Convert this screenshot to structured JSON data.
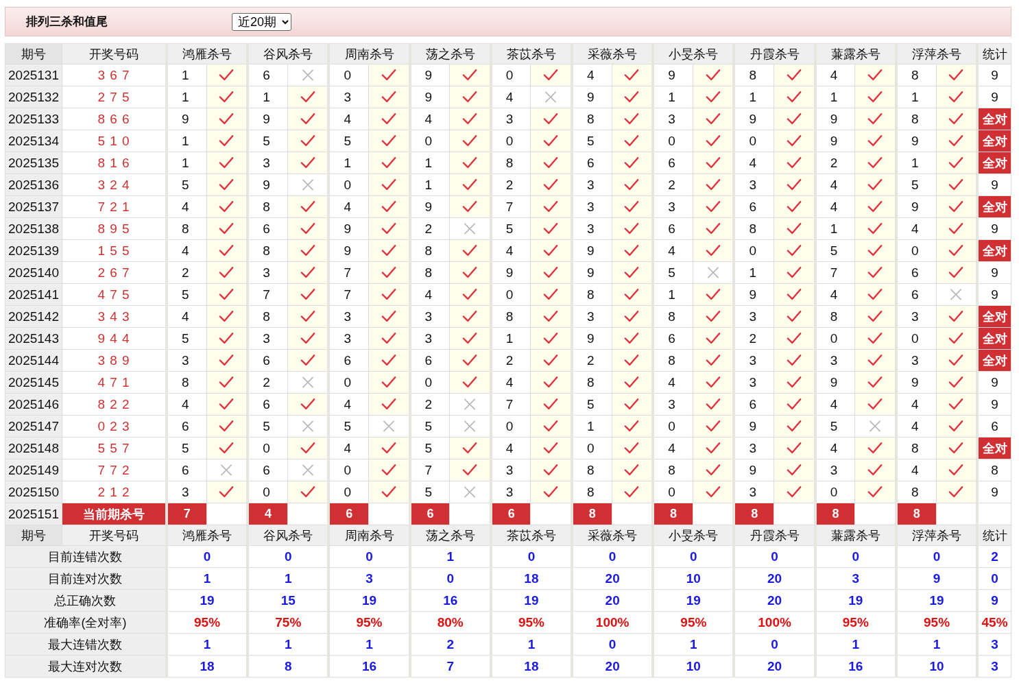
{
  "title": "排列三杀和值尾",
  "period_select": {
    "value": "近20期"
  },
  "columns": [
    "期号",
    "开奖号码",
    "鸿雁杀号",
    "谷风杀号",
    "周南杀号",
    "荡之杀号",
    "茶苡杀号",
    "采薇杀号",
    "小旻杀号",
    "丹霞杀号",
    "蒹露杀号",
    "浮萍杀号",
    "统计"
  ],
  "rows": [
    {
      "period": "2025131",
      "draw": "3 6 7",
      "kills": [
        {
          "digit": "1",
          "hit": true
        },
        {
          "digit": "6",
          "hit": false
        },
        {
          "digit": "0",
          "hit": true
        },
        {
          "digit": "9",
          "hit": true
        },
        {
          "digit": "0",
          "hit": true
        },
        {
          "digit": "4",
          "hit": true
        },
        {
          "digit": "9",
          "hit": true
        },
        {
          "digit": "8",
          "hit": true
        },
        {
          "digit": "4",
          "hit": true
        },
        {
          "digit": "8",
          "hit": true
        }
      ],
      "result": {
        "kind": "count",
        "text": "9"
      }
    },
    {
      "period": "2025132",
      "draw": "2 7 5",
      "kills": [
        {
          "digit": "1",
          "hit": true
        },
        {
          "digit": "1",
          "hit": true
        },
        {
          "digit": "3",
          "hit": true
        },
        {
          "digit": "9",
          "hit": true
        },
        {
          "digit": "4",
          "hit": false
        },
        {
          "digit": "9",
          "hit": true
        },
        {
          "digit": "1",
          "hit": true
        },
        {
          "digit": "1",
          "hit": true
        },
        {
          "digit": "1",
          "hit": true
        },
        {
          "digit": "1",
          "hit": true
        }
      ],
      "result": {
        "kind": "count",
        "text": "9"
      }
    },
    {
      "period": "2025133",
      "draw": "8 6 6",
      "kills": [
        {
          "digit": "9",
          "hit": true
        },
        {
          "digit": "9",
          "hit": true
        },
        {
          "digit": "4",
          "hit": true
        },
        {
          "digit": "4",
          "hit": true
        },
        {
          "digit": "3",
          "hit": true
        },
        {
          "digit": "8",
          "hit": true
        },
        {
          "digit": "3",
          "hit": true
        },
        {
          "digit": "9",
          "hit": true
        },
        {
          "digit": "9",
          "hit": true
        },
        {
          "digit": "8",
          "hit": true
        }
      ],
      "result": {
        "kind": "all",
        "text": "全对"
      }
    },
    {
      "period": "2025134",
      "draw": "5 1 0",
      "kills": [
        {
          "digit": "1",
          "hit": true
        },
        {
          "digit": "5",
          "hit": true
        },
        {
          "digit": "5",
          "hit": true
        },
        {
          "digit": "0",
          "hit": true
        },
        {
          "digit": "0",
          "hit": true
        },
        {
          "digit": "5",
          "hit": true
        },
        {
          "digit": "0",
          "hit": true
        },
        {
          "digit": "0",
          "hit": true
        },
        {
          "digit": "9",
          "hit": true
        },
        {
          "digit": "9",
          "hit": true
        }
      ],
      "result": {
        "kind": "all",
        "text": "全对"
      }
    },
    {
      "period": "2025135",
      "draw": "8 1 6",
      "kills": [
        {
          "digit": "1",
          "hit": true
        },
        {
          "digit": "3",
          "hit": true
        },
        {
          "digit": "1",
          "hit": true
        },
        {
          "digit": "1",
          "hit": true
        },
        {
          "digit": "8",
          "hit": true
        },
        {
          "digit": "6",
          "hit": true
        },
        {
          "digit": "6",
          "hit": true
        },
        {
          "digit": "4",
          "hit": true
        },
        {
          "digit": "2",
          "hit": true
        },
        {
          "digit": "1",
          "hit": true
        }
      ],
      "result": {
        "kind": "all",
        "text": "全对"
      }
    },
    {
      "period": "2025136",
      "draw": "3 2 4",
      "kills": [
        {
          "digit": "5",
          "hit": true
        },
        {
          "digit": "9",
          "hit": false
        },
        {
          "digit": "0",
          "hit": true
        },
        {
          "digit": "1",
          "hit": true
        },
        {
          "digit": "2",
          "hit": true
        },
        {
          "digit": "3",
          "hit": true
        },
        {
          "digit": "2",
          "hit": true
        },
        {
          "digit": "3",
          "hit": true
        },
        {
          "digit": "4",
          "hit": true
        },
        {
          "digit": "5",
          "hit": true
        }
      ],
      "result": {
        "kind": "count",
        "text": "9"
      }
    },
    {
      "period": "2025137",
      "draw": "7 2 1",
      "kills": [
        {
          "digit": "4",
          "hit": true
        },
        {
          "digit": "8",
          "hit": true
        },
        {
          "digit": "4",
          "hit": true
        },
        {
          "digit": "9",
          "hit": true
        },
        {
          "digit": "7",
          "hit": true
        },
        {
          "digit": "3",
          "hit": true
        },
        {
          "digit": "3",
          "hit": true
        },
        {
          "digit": "6",
          "hit": true
        },
        {
          "digit": "4",
          "hit": true
        },
        {
          "digit": "9",
          "hit": true
        }
      ],
      "result": {
        "kind": "all",
        "text": "全对"
      }
    },
    {
      "period": "2025138",
      "draw": "8 9 5",
      "kills": [
        {
          "digit": "8",
          "hit": true
        },
        {
          "digit": "6",
          "hit": true
        },
        {
          "digit": "9",
          "hit": true
        },
        {
          "digit": "2",
          "hit": false
        },
        {
          "digit": "5",
          "hit": true
        },
        {
          "digit": "3",
          "hit": true
        },
        {
          "digit": "6",
          "hit": true
        },
        {
          "digit": "8",
          "hit": true
        },
        {
          "digit": "1",
          "hit": true
        },
        {
          "digit": "4",
          "hit": true
        }
      ],
      "result": {
        "kind": "count",
        "text": "9"
      }
    },
    {
      "period": "2025139",
      "draw": "1 5 5",
      "kills": [
        {
          "digit": "4",
          "hit": true
        },
        {
          "digit": "8",
          "hit": true
        },
        {
          "digit": "9",
          "hit": true
        },
        {
          "digit": "8",
          "hit": true
        },
        {
          "digit": "4",
          "hit": true
        },
        {
          "digit": "9",
          "hit": true
        },
        {
          "digit": "4",
          "hit": true
        },
        {
          "digit": "0",
          "hit": true
        },
        {
          "digit": "5",
          "hit": true
        },
        {
          "digit": "0",
          "hit": true
        }
      ],
      "result": {
        "kind": "all",
        "text": "全对"
      }
    },
    {
      "period": "2025140",
      "draw": "2 6 7",
      "kills": [
        {
          "digit": "2",
          "hit": true
        },
        {
          "digit": "3",
          "hit": true
        },
        {
          "digit": "7",
          "hit": true
        },
        {
          "digit": "8",
          "hit": true
        },
        {
          "digit": "9",
          "hit": true
        },
        {
          "digit": "9",
          "hit": true
        },
        {
          "digit": "5",
          "hit": false
        },
        {
          "digit": "1",
          "hit": true
        },
        {
          "digit": "7",
          "hit": true
        },
        {
          "digit": "6",
          "hit": true
        }
      ],
      "result": {
        "kind": "count",
        "text": "9"
      }
    },
    {
      "period": "2025141",
      "draw": "4 7 5",
      "kills": [
        {
          "digit": "5",
          "hit": true
        },
        {
          "digit": "7",
          "hit": true
        },
        {
          "digit": "7",
          "hit": true
        },
        {
          "digit": "4",
          "hit": true
        },
        {
          "digit": "0",
          "hit": true
        },
        {
          "digit": "8",
          "hit": true
        },
        {
          "digit": "1",
          "hit": true
        },
        {
          "digit": "9",
          "hit": true
        },
        {
          "digit": "4",
          "hit": true
        },
        {
          "digit": "6",
          "hit": false
        }
      ],
      "result": {
        "kind": "count",
        "text": "9"
      }
    },
    {
      "period": "2025142",
      "draw": "3 4 3",
      "kills": [
        {
          "digit": "4",
          "hit": true
        },
        {
          "digit": "8",
          "hit": true
        },
        {
          "digit": "3",
          "hit": true
        },
        {
          "digit": "3",
          "hit": true
        },
        {
          "digit": "8",
          "hit": true
        },
        {
          "digit": "3",
          "hit": true
        },
        {
          "digit": "8",
          "hit": true
        },
        {
          "digit": "3",
          "hit": true
        },
        {
          "digit": "8",
          "hit": true
        },
        {
          "digit": "3",
          "hit": true
        }
      ],
      "result": {
        "kind": "all",
        "text": "全对"
      }
    },
    {
      "period": "2025143",
      "draw": "9 4 4",
      "kills": [
        {
          "digit": "5",
          "hit": true
        },
        {
          "digit": "3",
          "hit": true
        },
        {
          "digit": "3",
          "hit": true
        },
        {
          "digit": "3",
          "hit": true
        },
        {
          "digit": "1",
          "hit": true
        },
        {
          "digit": "9",
          "hit": true
        },
        {
          "digit": "6",
          "hit": true
        },
        {
          "digit": "2",
          "hit": true
        },
        {
          "digit": "0",
          "hit": true
        },
        {
          "digit": "0",
          "hit": true
        }
      ],
      "result": {
        "kind": "all",
        "text": "全对"
      }
    },
    {
      "period": "2025144",
      "draw": "3 8 9",
      "kills": [
        {
          "digit": "3",
          "hit": true
        },
        {
          "digit": "6",
          "hit": true
        },
        {
          "digit": "6",
          "hit": true
        },
        {
          "digit": "6",
          "hit": true
        },
        {
          "digit": "2",
          "hit": true
        },
        {
          "digit": "2",
          "hit": true
        },
        {
          "digit": "8",
          "hit": true
        },
        {
          "digit": "3",
          "hit": true
        },
        {
          "digit": "3",
          "hit": true
        },
        {
          "digit": "3",
          "hit": true
        }
      ],
      "result": {
        "kind": "all",
        "text": "全对"
      }
    },
    {
      "period": "2025145",
      "draw": "4 7 1",
      "kills": [
        {
          "digit": "8",
          "hit": true
        },
        {
          "digit": "2",
          "hit": false
        },
        {
          "digit": "0",
          "hit": true
        },
        {
          "digit": "0",
          "hit": true
        },
        {
          "digit": "4",
          "hit": true
        },
        {
          "digit": "8",
          "hit": true
        },
        {
          "digit": "4",
          "hit": true
        },
        {
          "digit": "3",
          "hit": true
        },
        {
          "digit": "9",
          "hit": true
        },
        {
          "digit": "9",
          "hit": true
        }
      ],
      "result": {
        "kind": "count",
        "text": "9"
      }
    },
    {
      "period": "2025146",
      "draw": "8 2 2",
      "kills": [
        {
          "digit": "4",
          "hit": true
        },
        {
          "digit": "6",
          "hit": true
        },
        {
          "digit": "4",
          "hit": true
        },
        {
          "digit": "2",
          "hit": false
        },
        {
          "digit": "7",
          "hit": true
        },
        {
          "digit": "5",
          "hit": true
        },
        {
          "digit": "3",
          "hit": true
        },
        {
          "digit": "6",
          "hit": true
        },
        {
          "digit": "4",
          "hit": true
        },
        {
          "digit": "4",
          "hit": true
        }
      ],
      "result": {
        "kind": "count",
        "text": "9"
      }
    },
    {
      "period": "2025147",
      "draw": "0 2 3",
      "kills": [
        {
          "digit": "6",
          "hit": true
        },
        {
          "digit": "5",
          "hit": false
        },
        {
          "digit": "5",
          "hit": false
        },
        {
          "digit": "5",
          "hit": false
        },
        {
          "digit": "0",
          "hit": true
        },
        {
          "digit": "1",
          "hit": true
        },
        {
          "digit": "0",
          "hit": true
        },
        {
          "digit": "9",
          "hit": true
        },
        {
          "digit": "5",
          "hit": false
        },
        {
          "digit": "4",
          "hit": true
        }
      ],
      "result": {
        "kind": "count",
        "text": "6"
      }
    },
    {
      "period": "2025148",
      "draw": "5 5 7",
      "kills": [
        {
          "digit": "5",
          "hit": true
        },
        {
          "digit": "0",
          "hit": true
        },
        {
          "digit": "4",
          "hit": true
        },
        {
          "digit": "5",
          "hit": true
        },
        {
          "digit": "4",
          "hit": true
        },
        {
          "digit": "0",
          "hit": true
        },
        {
          "digit": "4",
          "hit": true
        },
        {
          "digit": "3",
          "hit": true
        },
        {
          "digit": "4",
          "hit": true
        },
        {
          "digit": "8",
          "hit": true
        }
      ],
      "result": {
        "kind": "all",
        "text": "全对"
      }
    },
    {
      "period": "2025149",
      "draw": "7 7 2",
      "kills": [
        {
          "digit": "6",
          "hit": false
        },
        {
          "digit": "6",
          "hit": false
        },
        {
          "digit": "0",
          "hit": true
        },
        {
          "digit": "7",
          "hit": true
        },
        {
          "digit": "3",
          "hit": true
        },
        {
          "digit": "8",
          "hit": true
        },
        {
          "digit": "8",
          "hit": true
        },
        {
          "digit": "9",
          "hit": true
        },
        {
          "digit": "3",
          "hit": true
        },
        {
          "digit": "4",
          "hit": true
        }
      ],
      "result": {
        "kind": "count",
        "text": "8"
      }
    },
    {
      "period": "2025150",
      "draw": "2 1 2",
      "kills": [
        {
          "digit": "3",
          "hit": true
        },
        {
          "digit": "0",
          "hit": true
        },
        {
          "digit": "0",
          "hit": true
        },
        {
          "digit": "5",
          "hit": false
        },
        {
          "digit": "3",
          "hit": true
        },
        {
          "digit": "8",
          "hit": true
        },
        {
          "digit": "0",
          "hit": true
        },
        {
          "digit": "3",
          "hit": true
        },
        {
          "digit": "0",
          "hit": true
        },
        {
          "digit": "8",
          "hit": true
        }
      ],
      "result": {
        "kind": "count",
        "text": "9"
      }
    }
  ],
  "current": {
    "period": "2025151",
    "label": "当前期杀号",
    "kills": [
      "7",
      "4",
      "6",
      "6",
      "6",
      "8",
      "8",
      "8",
      "8",
      "8"
    ]
  },
  "footer_columns": [
    "期号",
    "开奖号码",
    "鸿雁杀号",
    "谷风杀号",
    "周南杀号",
    "荡之杀号",
    "茶苡杀号",
    "采薇杀号",
    "小旻杀号",
    "丹霞杀号",
    "蒹露杀号",
    "浮萍杀号",
    "统计"
  ],
  "stats": [
    {
      "label": "目前连错次数",
      "kind": "count",
      "values": [
        "0",
        "0",
        "0",
        "1",
        "0",
        "0",
        "0",
        "0",
        "0",
        "0",
        "2"
      ]
    },
    {
      "label": "目前连对次数",
      "kind": "count",
      "values": [
        "1",
        "1",
        "3",
        "0",
        "18",
        "20",
        "10",
        "20",
        "3",
        "9",
        "0"
      ]
    },
    {
      "label": "总正确次数",
      "kind": "count",
      "values": [
        "19",
        "15",
        "19",
        "16",
        "19",
        "20",
        "19",
        "20",
        "19",
        "19",
        "9"
      ]
    },
    {
      "label": "准确率(全对率)",
      "kind": "rate",
      "values": [
        "95%",
        "75%",
        "95%",
        "80%",
        "95%",
        "100%",
        "95%",
        "100%",
        "95%",
        "95%",
        "45%"
      ]
    },
    {
      "label": "最大连错次数",
      "kind": "count",
      "values": [
        "1",
        "1",
        "1",
        "2",
        "1",
        "0",
        "1",
        "0",
        "1",
        "1",
        "3"
      ]
    },
    {
      "label": "最大连对次数",
      "kind": "count",
      "values": [
        "18",
        "8",
        "16",
        "7",
        "18",
        "20",
        "10",
        "20",
        "16",
        "10",
        "3"
      ]
    }
  ]
}
